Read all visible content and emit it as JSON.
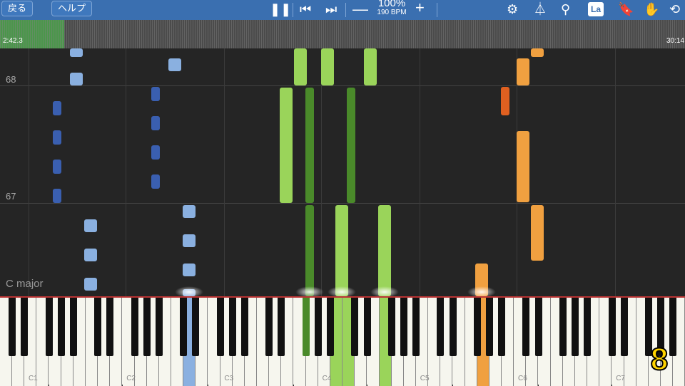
{
  "toolbar": {
    "back_label": "戻る",
    "help_label": "ヘルプ",
    "pause_icon": "pause-icon",
    "prev_icon": "skip-back-icon",
    "next_icon": "skip-forward-icon",
    "minus_label": "—",
    "tempo_percent": "100%",
    "tempo_bpm": "190 BPM",
    "plus_label": "+",
    "la_label": "La"
  },
  "timeline": {
    "current_time": "2:42.3",
    "total_time": "30:14",
    "progress": 0.094
  },
  "roll": {
    "row_labels": [
      "68",
      "67"
    ],
    "key_name": "C major"
  },
  "keyboard": {
    "octave_labels": [
      "C1",
      "C2",
      "C3",
      "C4",
      "C5",
      "C6",
      "C7"
    ]
  },
  "counter": "8",
  "colors": {
    "toolbar": "#3a6fb0",
    "left_hand": "#3a5fb0",
    "left_hand_light": "#8ab0e0",
    "right_hand": "#9ad45a",
    "right_hand_dark": "#4a8a2a",
    "orange": "#f0a040",
    "orange_dark": "#e06020",
    "counter": "#ffd400"
  }
}
